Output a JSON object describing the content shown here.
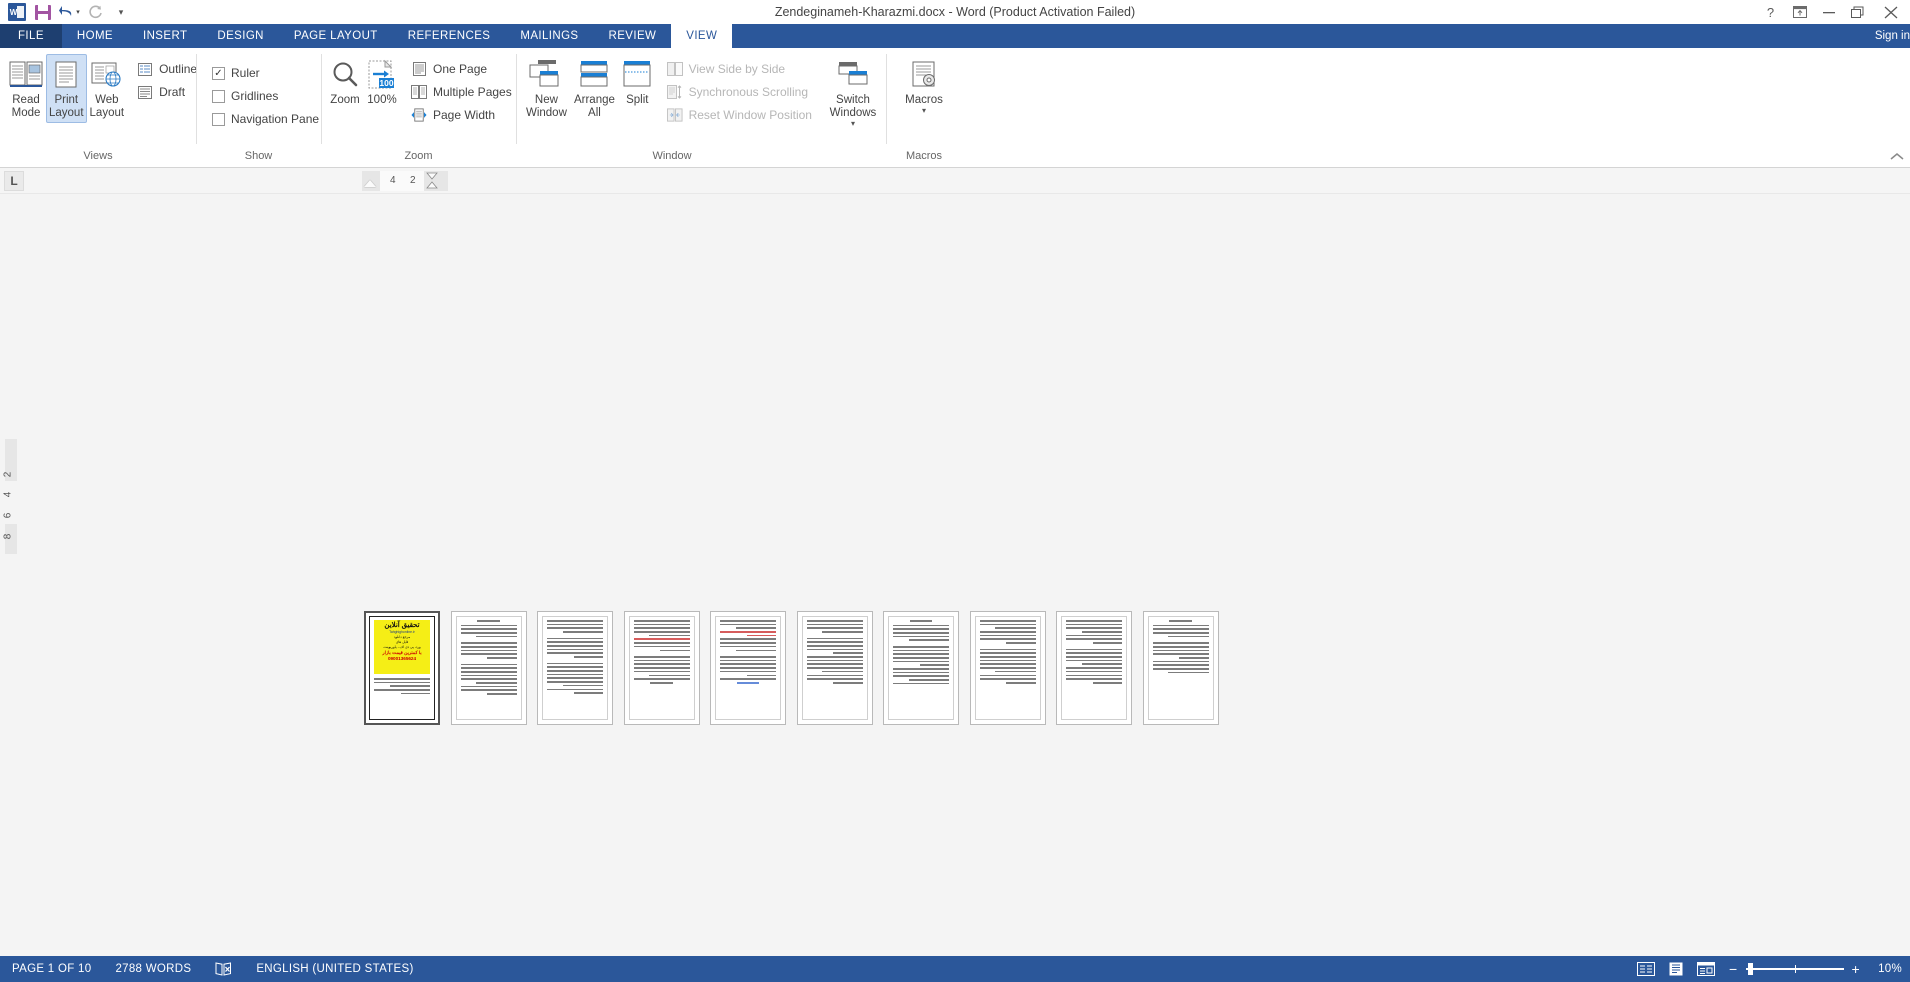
{
  "window": {
    "title": "Zendeginameh-Kharazmi.docx - Word (Product Activation Failed)",
    "help_label": "?",
    "ribbon_display_label": "ribbon-display-options",
    "minimize_label": "minimize",
    "restore_label": "restore",
    "close_label": "close"
  },
  "quick_access": {
    "word_logo": "W",
    "save": "save-icon",
    "undo": "undo-icon",
    "redo": "redo-icon",
    "customize": "customize-quick-access-icon"
  },
  "tabs": {
    "file": "FILE",
    "items": [
      {
        "label": "HOME",
        "active": false
      },
      {
        "label": "INSERT",
        "active": false
      },
      {
        "label": "DESIGN",
        "active": false
      },
      {
        "label": "PAGE LAYOUT",
        "active": false
      },
      {
        "label": "REFERENCES",
        "active": false
      },
      {
        "label": "MAILINGS",
        "active": false
      },
      {
        "label": "REVIEW",
        "active": false
      },
      {
        "label": "VIEW",
        "active": true
      }
    ],
    "signin": "Sign in"
  },
  "ribbon": {
    "groups": {
      "views": {
        "label": "Views",
        "read_mode": "Read\nMode",
        "print_layout": "Print\nLayout",
        "web_layout": "Web\nLayout",
        "outline": "Outline",
        "draft": "Draft"
      },
      "show": {
        "label": "Show",
        "ruler": "Ruler",
        "ruler_checked": true,
        "gridlines": "Gridlines",
        "gridlines_checked": false,
        "navigation_pane": "Navigation Pane",
        "navigation_pane_checked": false
      },
      "zoom": {
        "label": "Zoom",
        "zoom_button": "Zoom",
        "hundred_percent": "100%",
        "badge": "100",
        "one_page": "One Page",
        "multiple_pages": "Multiple Pages",
        "page_width": "Page Width"
      },
      "window": {
        "label": "Window",
        "new_window": "New\nWindow",
        "arrange_all": "Arrange\nAll",
        "split": "Split",
        "view_side_by_side": "View Side by Side",
        "synchronous_scrolling": "Synchronous Scrolling",
        "reset_window_position": "Reset Window Position",
        "switch_windows": "Switch\nWindows"
      },
      "macros": {
        "label": "Macros",
        "macros_button": "Macros"
      }
    },
    "collapse": "collapse-ribbon-icon"
  },
  "ruler": {
    "tab_selector": "L",
    "marks": [
      "4",
      "2"
    ],
    "vertical_marks": [
      "2",
      "4",
      "6",
      "8"
    ]
  },
  "document": {
    "page_count": 10,
    "ad": {
      "title": "تحقیق آنلاین",
      "brand": "Tahghighonline.ir",
      "line1": "مرجع دانلود",
      "line2": "فایل های",
      "line3": "ورد، پی دی اف ، پاورپوینت",
      "line4": "با کمترین قیمت بازار",
      "phone": "09001365624"
    }
  },
  "status": {
    "page": "PAGE 1 OF 10",
    "words": "2788 WORDS",
    "proofing_icon": "proofing-errors-icon",
    "language": "ENGLISH (UNITED STATES)",
    "view_read_mode": "read-mode-icon",
    "view_print_layout": "print-layout-icon",
    "view_web_layout": "web-layout-icon",
    "zoom_out": "−",
    "zoom_in": "+",
    "zoom_level": "10%"
  },
  "colors": {
    "brand": "#2b579a",
    "file_tab": "#1e3f70",
    "selected": "#cfe0f5",
    "highlight_yellow": "#f5ee16",
    "red_text": "#cc0000"
  }
}
